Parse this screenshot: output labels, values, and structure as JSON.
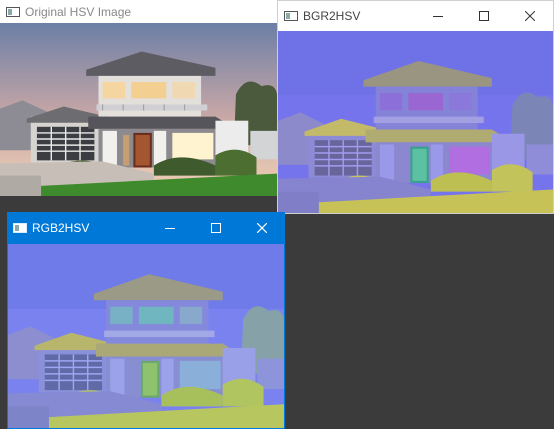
{
  "windows": {
    "original": {
      "title": "Original HSV Image"
    },
    "bgr": {
      "title": "BGR2HSV"
    },
    "rgb": {
      "title": "RGB2HSV"
    }
  },
  "icons": [
    "window-app-icon",
    "minimize-icon",
    "maximize-icon",
    "close-icon"
  ],
  "colors": {
    "desktop": "#3b3b3b",
    "active_titlebar": "#0078d7",
    "bgr_tint": "#7a78f0",
    "rgb_tint": "#7d83f2"
  }
}
